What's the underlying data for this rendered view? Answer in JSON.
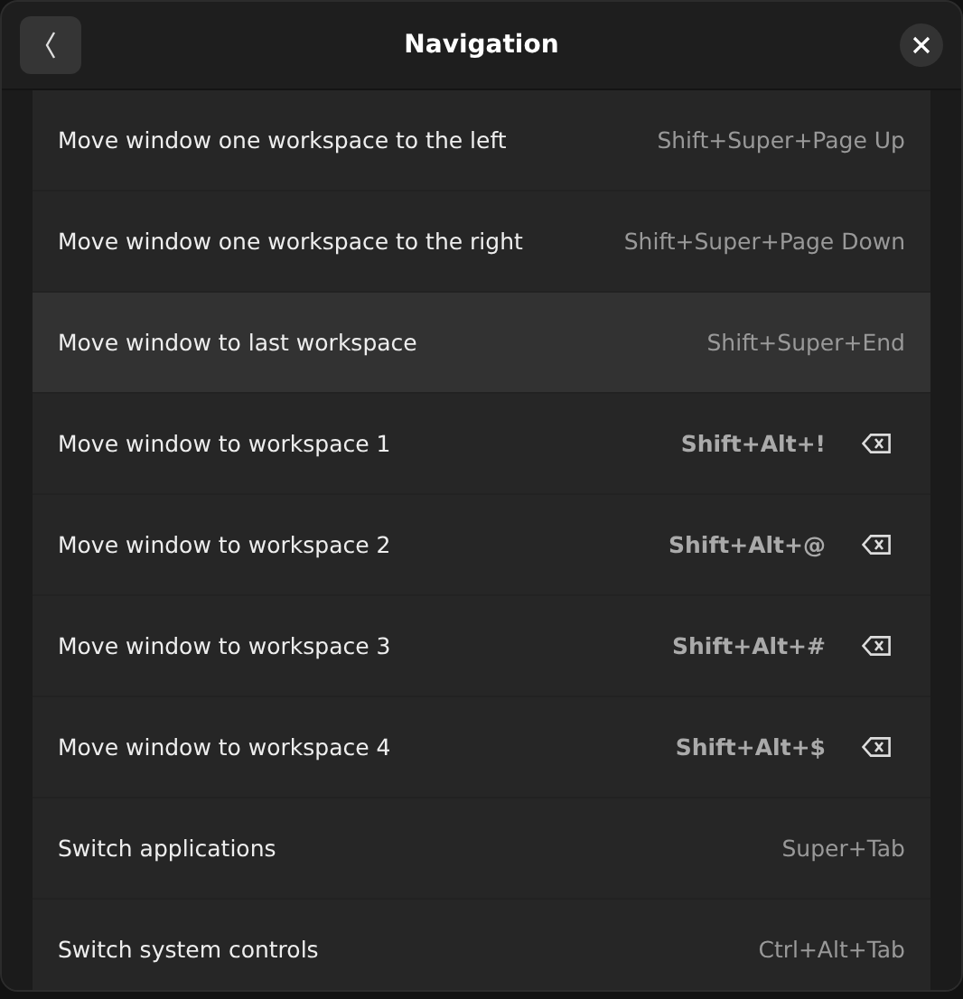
{
  "window": {
    "title": "Navigation"
  },
  "rows": [
    {
      "label": "Move window one workspace to the left",
      "shortcut": "Shift+Super+Page Up",
      "custom": false,
      "selected": false
    },
    {
      "label": "Move window one workspace to the right",
      "shortcut": "Shift+Super+Page Down",
      "custom": false,
      "selected": false
    },
    {
      "label": "Move window to last workspace",
      "shortcut": "Shift+Super+End",
      "custom": false,
      "selected": true
    },
    {
      "label": "Move window to workspace 1",
      "shortcut": "Shift+Alt+!",
      "custom": true,
      "selected": false
    },
    {
      "label": "Move window to workspace 2",
      "shortcut": "Shift+Alt+@",
      "custom": true,
      "selected": false
    },
    {
      "label": "Move window to workspace 3",
      "shortcut": "Shift+Alt+#",
      "custom": true,
      "selected": false
    },
    {
      "label": "Move window to workspace 4",
      "shortcut": "Shift+Alt+$",
      "custom": true,
      "selected": false
    },
    {
      "label": "Switch applications",
      "shortcut": "Super+Tab",
      "custom": false,
      "selected": false
    },
    {
      "label": "Switch system controls",
      "shortcut": "Ctrl+Alt+Tab",
      "custom": false,
      "selected": false
    }
  ]
}
